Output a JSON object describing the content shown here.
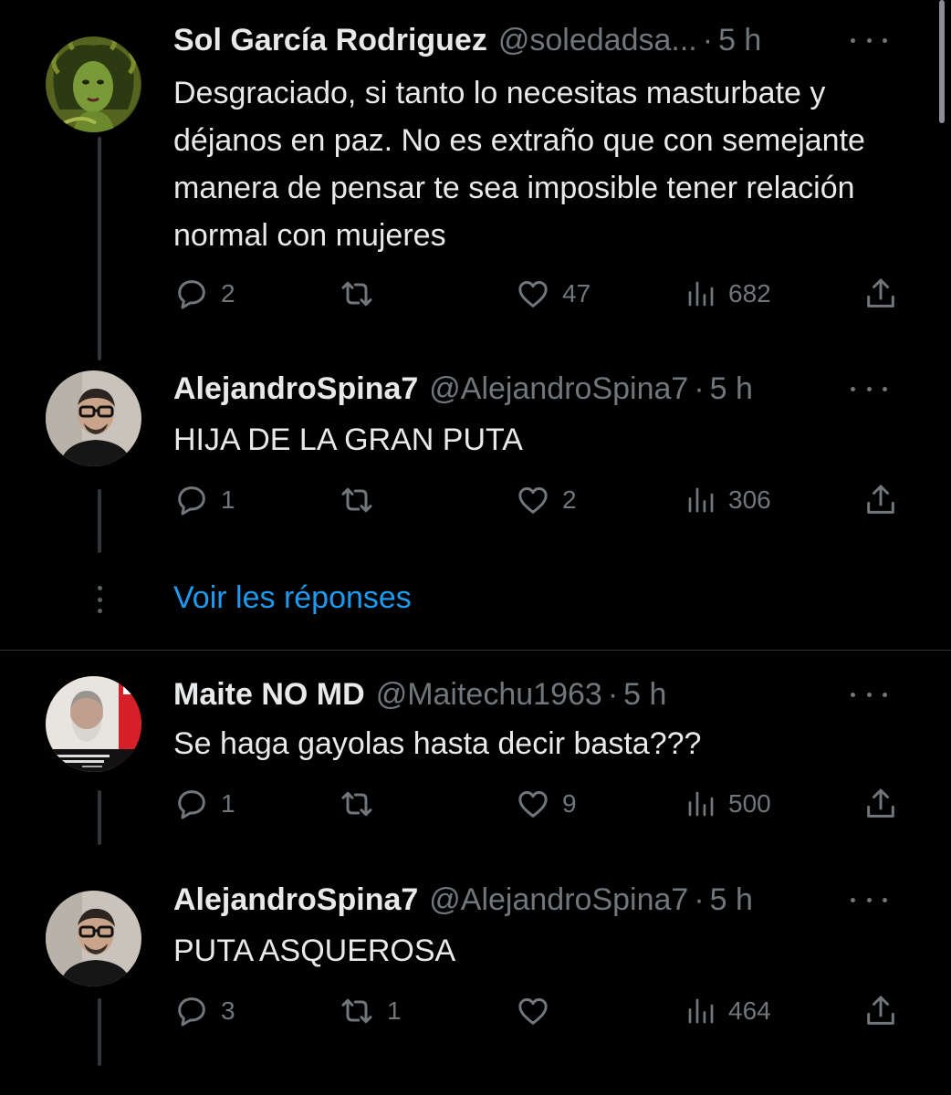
{
  "tweets": [
    {
      "name": "Sol García Rodriguez",
      "handle": "@soledadsa...",
      "time": "5 h",
      "separator": "·",
      "text": "Desgraciado, si tanto lo necesitas masturbate y déjanos en paz. No es extraño que con semejante manera de pensar te sea imposible tener relación normal con mujeres",
      "replies": "2",
      "retweets": "",
      "likes": "47",
      "views": "682",
      "avatar_icon": "medusa-illustration-avatar"
    },
    {
      "name": "AlejandroSpina7",
      "handle": "@AlejandroSpina7",
      "time": "5 h",
      "separator": "·",
      "text": "HIJA DE LA GRAN PUTA",
      "replies": "1",
      "retweets": "",
      "likes": "2",
      "views": "306",
      "avatar_icon": "man-with-glasses-avatar"
    },
    {
      "name": "Maite NO MD",
      "handle": "@Maitechu1963",
      "time": "5 h",
      "separator": "·",
      "text": "Se haga gayolas hasta decir basta???",
      "replies": "1",
      "retweets": "",
      "likes": "9",
      "views": "500",
      "avatar_icon": "bearded-man-red-background-avatar"
    },
    {
      "name": "AlejandroSpina7",
      "handle": "@AlejandroSpina7",
      "time": "5 h",
      "separator": "·",
      "text": "PUTA ASQUEROSA",
      "replies": "3",
      "retweets": "1",
      "likes": "",
      "views": "464",
      "avatar_icon": "man-with-glasses-avatar"
    }
  ],
  "show_replies_label": "Voir les réponses",
  "colors": {
    "background": "#000000",
    "text_primary": "#e7e9ea",
    "text_secondary": "#71767b",
    "link": "#1d9bf0",
    "thread_line": "#333639",
    "divider": "#2f3336"
  },
  "icons": {
    "reply": "reply-icon",
    "retweet": "retweet-icon",
    "like": "heart-icon",
    "views": "views-icon",
    "share": "share-icon",
    "more": "more-options-icon"
  }
}
